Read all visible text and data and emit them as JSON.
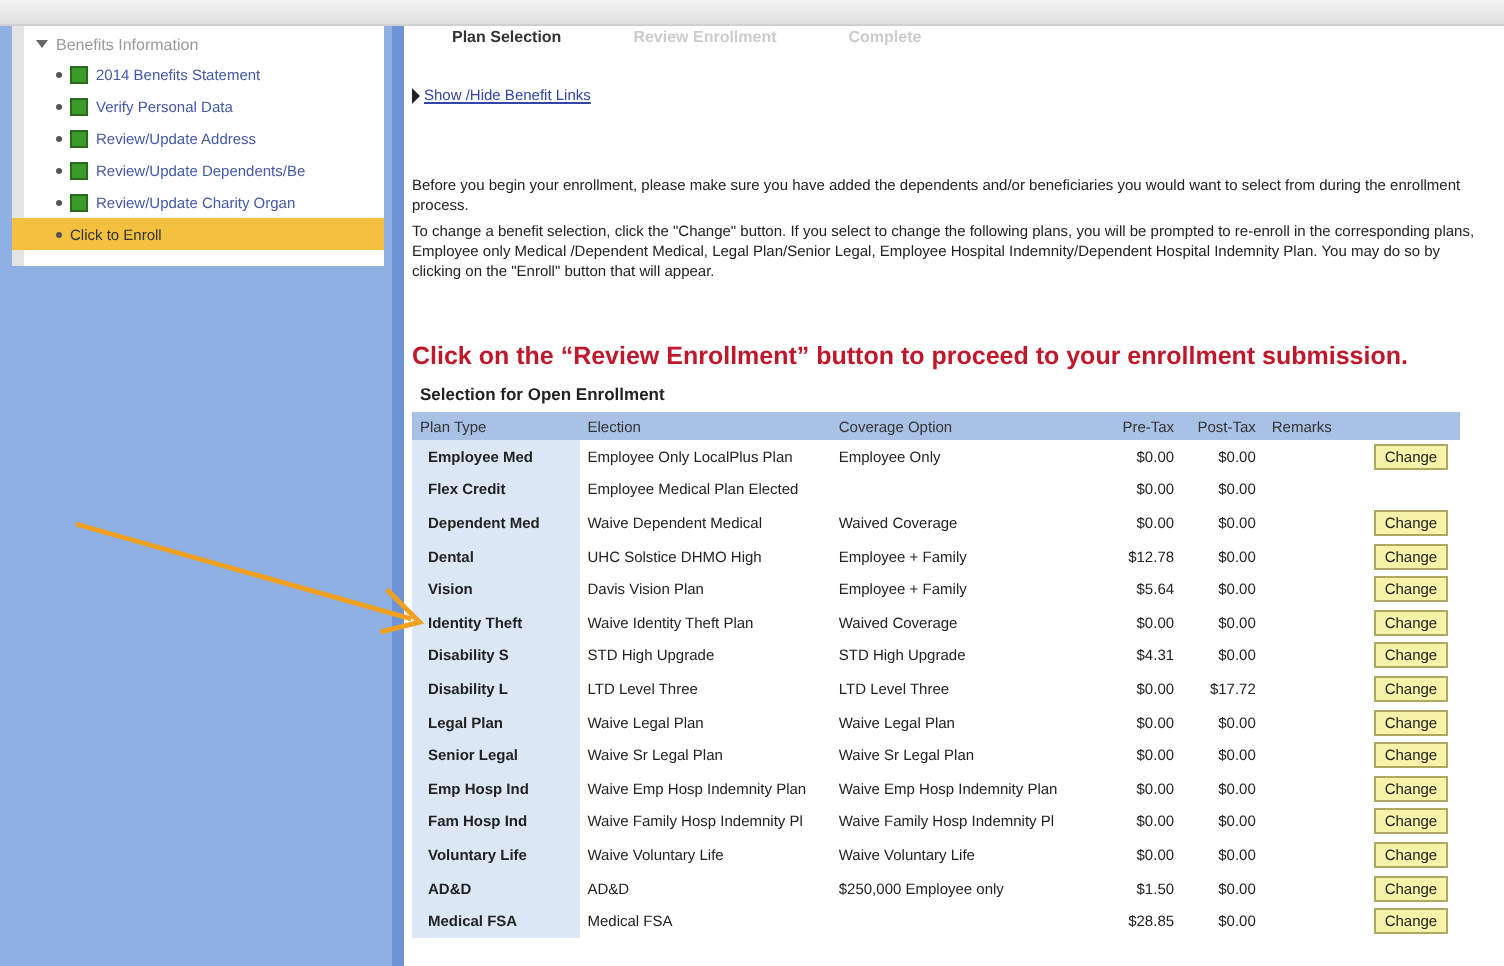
{
  "sidebar": {
    "items": [
      {
        "kind": "group",
        "label": "Benefits Information",
        "expanded": true,
        "children": [
          {
            "kind": "task",
            "label": "2014 Benefits Statement",
            "selected": false
          },
          {
            "kind": "task",
            "label": "Verify Personal Data",
            "selected": false
          },
          {
            "kind": "task",
            "label": "Review/Update Address",
            "selected": false
          },
          {
            "kind": "task",
            "label": "Review/Update Dependents/Be",
            "selected": false
          },
          {
            "kind": "task",
            "label": "Review/Update Charity Organ",
            "selected": false
          },
          {
            "kind": "link",
            "label": "Click to Enroll",
            "selected": true
          }
        ]
      }
    ]
  },
  "steps": [
    {
      "label": "Plan Selection",
      "selected": true
    },
    {
      "label": "Review Enrollment",
      "selected": false
    },
    {
      "label": "Complete",
      "selected": false
    }
  ],
  "benefit_links_toggle": "Show /Hide Benefit Links",
  "instructions": [
    "Before you begin your enrollment, please make sure you have added the dependents and/or beneficiaries you would want to select from during the enrollment process.",
    "To change a benefit selection, click the \"Change\" button.   If you select to change the following plans, you will be prompted to re-enroll in the corresponding plans, Employee only Medical /Dependent Medical, Legal Plan/Senior Legal, Employee Hospital Indemnity/Dependent Hospital Indemnity Plan.  You may do so by clicking on the \"Enroll\" button that will appear."
  ],
  "notice": "Click on the “Review Enrollment” button to proceed to your enrollment submission.",
  "table": {
    "title": "Selection for Open Enrollment",
    "columns": [
      "Plan Type",
      "Election",
      "Coverage Option",
      "Pre-Tax",
      "Post-Tax",
      "Remarks"
    ],
    "rows": [
      {
        "plan_type": "Employee Med",
        "election": "Employee Only LocalPlus Plan",
        "coverage": "Employee Only",
        "pre_tax": "$0.00",
        "post_tax": "$0.00",
        "action": "Change"
      },
      {
        "plan_type": "Flex Credit",
        "election": "Employee Medical Plan Elected",
        "pre_tax": "$0.00",
        "post_tax": "$0.00"
      },
      {
        "plan_type": "Dependent Med",
        "election": "Waive Dependent  Medical",
        "coverage": "Waived Coverage",
        "pre_tax": "$0.00",
        "post_tax": "$0.00",
        "action": "Change"
      },
      {
        "plan_type": "Dental",
        "election": "UHC Solstice DHMO High",
        "coverage": "Employee + Family",
        "pre_tax": "$12.78",
        "post_tax": "$0.00",
        "action": "Change"
      },
      {
        "plan_type": "Vision",
        "election": "Davis Vision Plan",
        "coverage": "Employee + Family",
        "pre_tax": "$5.64",
        "post_tax": "$0.00",
        "action": "Change"
      },
      {
        "plan_type": "Identity Theft",
        "election": "Waive Identity Theft Plan",
        "coverage": "Waived Coverage",
        "pre_tax": "$0.00",
        "post_tax": "$0.00",
        "action": "Change"
      },
      {
        "plan_type": "Disability S",
        "election": "STD High Upgrade",
        "coverage": "STD High Upgrade",
        "pre_tax": "$4.31",
        "post_tax": "$0.00",
        "action": "Change"
      },
      {
        "plan_type": "Disability L",
        "election": "LTD Level Three",
        "coverage": "LTD Level Three",
        "pre_tax": "$0.00",
        "post_tax": "$17.72",
        "action": "Change"
      },
      {
        "plan_type": "Legal Plan",
        "election": "Waive Legal Plan",
        "coverage": "Waive Legal Plan",
        "pre_tax": "$0.00",
        "post_tax": "$0.00",
        "action": "Change"
      },
      {
        "plan_type": "Senior Legal",
        "election": "Waive Sr Legal Plan",
        "coverage": "Waive Sr Legal Plan",
        "pre_tax": "$0.00",
        "post_tax": "$0.00",
        "action": "Change"
      },
      {
        "plan_type": "Emp Hosp Ind",
        "election": "Waive Emp Hosp  Indemnity Plan",
        "coverage": "Waive Emp Hosp  Indemnity Plan",
        "pre_tax": "$0.00",
        "post_tax": "$0.00",
        "action": "Change"
      },
      {
        "plan_type": "Fam Hosp Ind",
        "election": "Waive Family Hosp Indemnity Pl",
        "coverage": "Waive Family Hosp Indemnity Pl",
        "pre_tax": "$0.00",
        "post_tax": "$0.00",
        "action": "Change"
      },
      {
        "plan_type": "Voluntary Life",
        "election": "Waive Voluntary Life",
        "coverage": "Waive Voluntary Life",
        "pre_tax": "$0.00",
        "post_tax": "$0.00",
        "action": "Change"
      },
      {
        "plan_type": "AD&D",
        "election": "AD&D",
        "coverage": "$250,000 Employee only",
        "pre_tax": "$1.50",
        "post_tax": "$0.00",
        "action": "Change"
      },
      {
        "plan_type": "Medical FSA",
        "election": "Medical FSA",
        "pre_tax": "$28.85",
        "post_tax": "$0.00",
        "action": "Change"
      }
    ]
  }
}
